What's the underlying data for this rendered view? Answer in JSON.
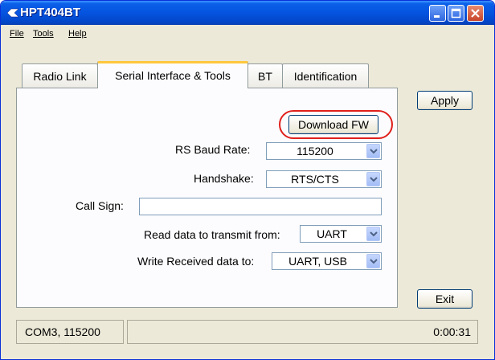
{
  "window": {
    "title": "HPT404BT"
  },
  "menu": {
    "file": "File",
    "tools": "Tools",
    "help": "Help"
  },
  "tabs": [
    {
      "label": "Radio Link"
    },
    {
      "label": "Serial Interface & Tools"
    },
    {
      "label": "BT"
    },
    {
      "label": "Identification"
    }
  ],
  "active_tab": "Serial Interface & Tools",
  "buttons": {
    "apply": "Apply",
    "exit": "Exit",
    "download_fw": "Download FW"
  },
  "form": {
    "rs_baud_rate": {
      "label": "RS Baud Rate:",
      "value": "115200"
    },
    "handshake": {
      "label": "Handshake:",
      "value": "RTS/CTS"
    },
    "call_sign": {
      "label": "Call Sign:",
      "value": ""
    },
    "read_data": {
      "label": "Read data to transmit from:",
      "value": "UART"
    },
    "write_data": {
      "label": "Write Received data to:",
      "value": "UART, USB"
    }
  },
  "status": {
    "port": "COM3, 115200",
    "time": "0:00:31"
  },
  "colors": {
    "titlebar": "#0554e0",
    "highlight_ring": "#e0201c",
    "active_tab_accent": "#ffc73c"
  }
}
